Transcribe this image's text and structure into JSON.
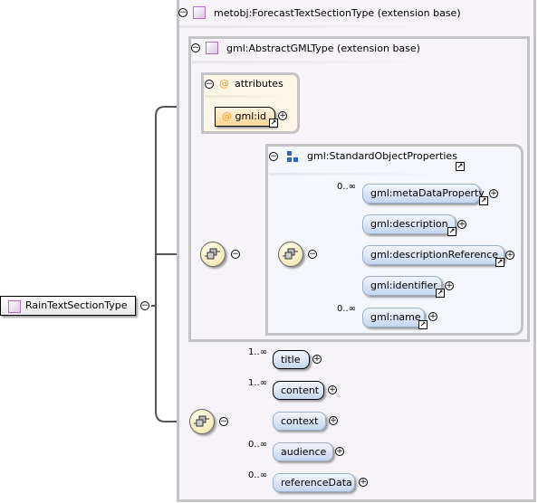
{
  "root": {
    "label": "RainTextSectionType"
  },
  "extension_outer": {
    "label": "metobj:ForecastTextSectionType (extension base)"
  },
  "extension_inner": {
    "label": "gml:AbstractGMLType (extension base)"
  },
  "attributes": {
    "label": "attributes",
    "items": [
      {
        "label": "gml:id"
      }
    ]
  },
  "group": {
    "label": "gml:StandardObjectProperties"
  },
  "group_elements": [
    {
      "label": "gml:metaDataProperty",
      "cardinality": "0..∞"
    },
    {
      "label": "gml:description",
      "cardinality": ""
    },
    {
      "label": "gml:descriptionReference",
      "cardinality": ""
    },
    {
      "label": "gml:identifier",
      "cardinality": ""
    },
    {
      "label": "gml:name",
      "cardinality": "0..∞"
    }
  ],
  "sequence_elements": [
    {
      "label": "title",
      "cardinality": "1..∞"
    },
    {
      "label": "content",
      "cardinality": "1..∞"
    },
    {
      "label": "context",
      "cardinality": ""
    },
    {
      "label": "audience",
      "cardinality": "0..∞"
    },
    {
      "label": "referenceData",
      "cardinality": "0..∞"
    }
  ],
  "colors": {
    "outer_bg": "#f7f4f9",
    "group_bg": "#f5f7fc",
    "attr_bg": "#fdf6e6",
    "element": "#c4d6ef",
    "compositor": "#ede3a0"
  }
}
